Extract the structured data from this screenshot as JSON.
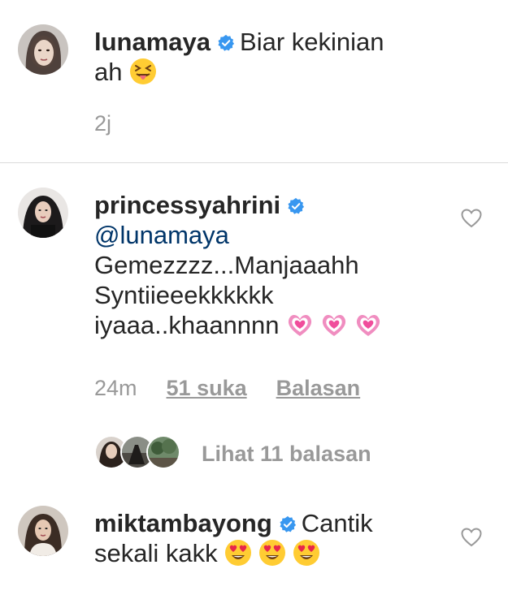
{
  "comments": [
    {
      "username": "lunamaya",
      "text_line1": "Biar kekinian",
      "text_line2": "ah",
      "emoji": "squinting-tongue-emoji",
      "time": "2j"
    },
    {
      "username": "princessyahrini",
      "mention": "@lunamaya",
      "text_line1": "Gemezzzz...Manjaaahh",
      "text_line2": "Syntiieeekkkkkk",
      "text_line3": "iyaaa..khaannnn",
      "emoji": "growing-heart-emoji",
      "time": "24m",
      "likes": "51 suka",
      "reply": "Balasan",
      "view_replies": "Lihat 11 balasan"
    },
    {
      "username": "miktambayong",
      "text_line1": "Cantik",
      "text_line2": "sekali kakk",
      "emoji": "heart-eyes-emoji"
    }
  ],
  "colors": {
    "text": "#262626",
    "meta": "#999999",
    "mention": "#003569",
    "verified": "#3897f0",
    "divider": "#dbdbdb"
  }
}
